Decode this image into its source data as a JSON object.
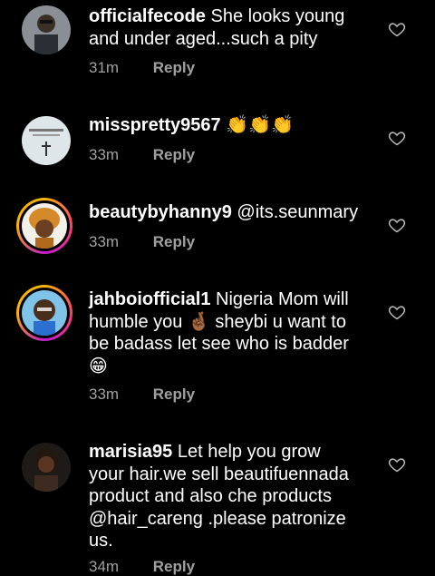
{
  "comments": [
    {
      "username": "officialfecode",
      "text": "She looks young and under aged...such a pity",
      "time": "31m",
      "reply": "Reply"
    },
    {
      "username": "misspretty9567",
      "text": "👏👏👏",
      "time": "33m",
      "reply": "Reply"
    },
    {
      "username": "beautybyhanny9",
      "text": "@its.seunmary",
      "time": "33m",
      "reply": "Reply"
    },
    {
      "username": "jahboiofficial1",
      "text": "Nigeria Mom will humble you 🤞🏾 sheybi u want to be badass let see who is badder 😁",
      "time": "33m",
      "reply": "Reply"
    },
    {
      "username": "marisia95",
      "text": "Let help you grow your hair.we sell beautifuennada product and also che products @hair_careng .please patronize us.",
      "time": "34m",
      "reply": "Reply"
    }
  ]
}
